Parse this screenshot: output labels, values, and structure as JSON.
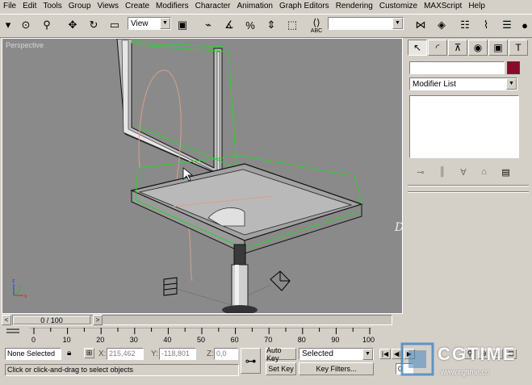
{
  "menu": [
    "File",
    "Edit",
    "Tools",
    "Group",
    "Views",
    "Create",
    "Modifiers",
    "Character",
    "Animation",
    "Graph Editors",
    "Rendering",
    "Customize",
    "MAXScript",
    "Help"
  ],
  "toolbar": {
    "reference_coord": "View",
    "selection_set_value": "",
    "abc_label": "ABC"
  },
  "viewport": {
    "label": "Perspective"
  },
  "command_panel": {
    "tabs": [
      "create-icon",
      "modify-icon",
      "hierarchy-icon",
      "motion-icon",
      "display-icon",
      "utilities-icon"
    ],
    "name_value": "",
    "color_swatch": "#8b0a2a",
    "modifier_list_label": "Modifier List"
  },
  "time_slider": {
    "position_label": "0 / 100",
    "prev_glyph": "<",
    "next_glyph": ">"
  },
  "ruler": {
    "ticks": [
      "0",
      "10",
      "20",
      "30",
      "40",
      "50",
      "60",
      "70",
      "80",
      "90",
      "100"
    ]
  },
  "status": {
    "selection": "None Selected",
    "x_label": "X:",
    "x_value": "215,462",
    "y_label": "Y:",
    "y_value": "-118,801",
    "z_label": "Z:",
    "z_value": "0,0",
    "auto_key": "Auto Key",
    "key_mode": "Selected",
    "set_key": "Set Key",
    "key_filters": "Key Filters...",
    "prompt": "Click or click-and-drag to select objects",
    "frame_value": "0"
  },
  "watermark": {
    "brand": "CGTIME",
    "url": "www.cgtime.cn"
  }
}
